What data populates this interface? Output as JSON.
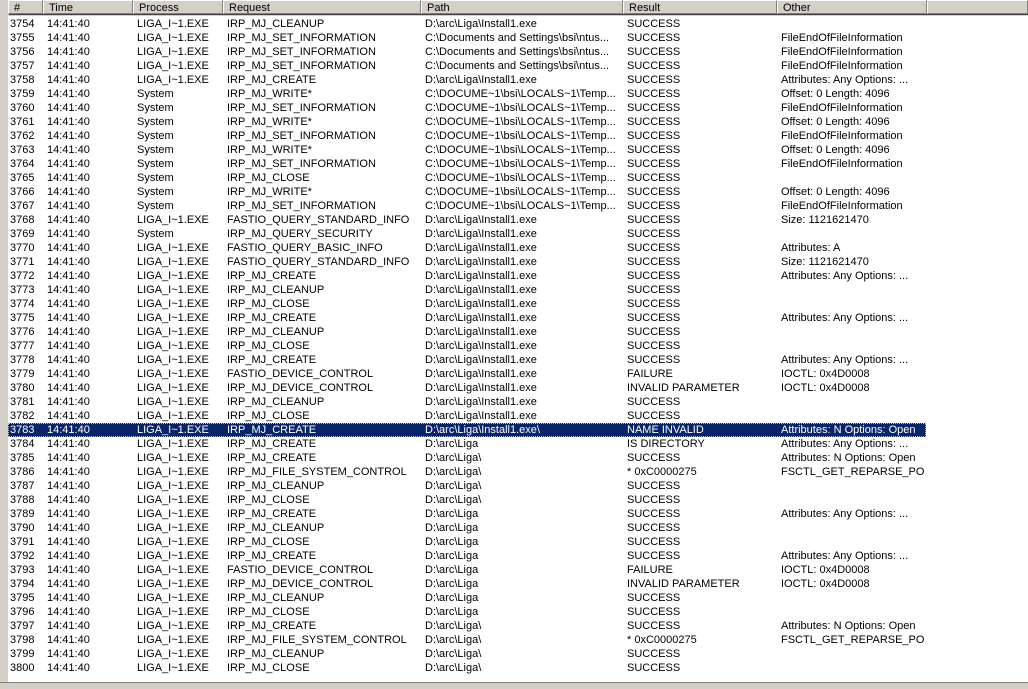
{
  "columns": [
    "#",
    "Time",
    "Process",
    "Request",
    "Path",
    "Result",
    "Other",
    ""
  ],
  "selected_index": 29,
  "selection_color": "#0a246a",
  "rows": [
    [
      "3754",
      "14:41:40",
      "LIGA_I~1.EXE",
      "IRP_MJ_CLEANUP",
      "D:\\arc\\Liga\\Install1.exe",
      "SUCCESS",
      ""
    ],
    [
      "3755",
      "14:41:40",
      "LIGA_I~1.EXE",
      "IRP_MJ_SET_INFORMATION",
      "C:\\Documents and Settings\\bsi\\ntus...",
      "SUCCESS",
      "FileEndOfFileInformation"
    ],
    [
      "3756",
      "14:41:40",
      "LIGA_I~1.EXE",
      "IRP_MJ_SET_INFORMATION",
      "C:\\Documents and Settings\\bsi\\ntus...",
      "SUCCESS",
      "FileEndOfFileInformation"
    ],
    [
      "3757",
      "14:41:40",
      "LIGA_I~1.EXE",
      "IRP_MJ_SET_INFORMATION",
      "C:\\Documents and Settings\\bsi\\ntus...",
      "SUCCESS",
      "FileEndOfFileInformation"
    ],
    [
      "3758",
      "14:41:40",
      "LIGA_I~1.EXE",
      "IRP_MJ_CREATE",
      "D:\\arc\\Liga\\Install1.exe",
      "SUCCESS",
      "Attributes: Any Options: ..."
    ],
    [
      "3759",
      "14:41:40",
      "System",
      "IRP_MJ_WRITE*",
      "C:\\DOCUME~1\\bsi\\LOCALS~1\\Temp...",
      "SUCCESS",
      "Offset: 0 Length: 4096"
    ],
    [
      "3760",
      "14:41:40",
      "System",
      "IRP_MJ_SET_INFORMATION",
      "C:\\DOCUME~1\\bsi\\LOCALS~1\\Temp...",
      "SUCCESS",
      "FileEndOfFileInformation"
    ],
    [
      "3761",
      "14:41:40",
      "System",
      "IRP_MJ_WRITE*",
      "C:\\DOCUME~1\\bsi\\LOCALS~1\\Temp...",
      "SUCCESS",
      "Offset: 0 Length: 4096"
    ],
    [
      "3762",
      "14:41:40",
      "System",
      "IRP_MJ_SET_INFORMATION",
      "C:\\DOCUME~1\\bsi\\LOCALS~1\\Temp...",
      "SUCCESS",
      "FileEndOfFileInformation"
    ],
    [
      "3763",
      "14:41:40",
      "System",
      "IRP_MJ_WRITE*",
      "C:\\DOCUME~1\\bsi\\LOCALS~1\\Temp...",
      "SUCCESS",
      "Offset: 0 Length: 4096"
    ],
    [
      "3764",
      "14:41:40",
      "System",
      "IRP_MJ_SET_INFORMATION",
      "C:\\DOCUME~1\\bsi\\LOCALS~1\\Temp...",
      "SUCCESS",
      "FileEndOfFileInformation"
    ],
    [
      "3765",
      "14:41:40",
      "System",
      "IRP_MJ_CLOSE",
      "C:\\DOCUME~1\\bsi\\LOCALS~1\\Temp...",
      "SUCCESS",
      ""
    ],
    [
      "3766",
      "14:41:40",
      "System",
      "IRP_MJ_WRITE*",
      "C:\\DOCUME~1\\bsi\\LOCALS~1\\Temp...",
      "SUCCESS",
      "Offset: 0 Length: 4096"
    ],
    [
      "3767",
      "14:41:40",
      "System",
      "IRP_MJ_SET_INFORMATION",
      "C:\\DOCUME~1\\bsi\\LOCALS~1\\Temp...",
      "SUCCESS",
      "FileEndOfFileInformation"
    ],
    [
      "3768",
      "14:41:40",
      "LIGA_I~1.EXE",
      "FASTIO_QUERY_STANDARD_INFO",
      "D:\\arc\\Liga\\Install1.exe",
      "SUCCESS",
      "Size: 1121621470"
    ],
    [
      "3769",
      "14:41:40",
      "System",
      "IRP_MJ_QUERY_SECURITY",
      "D:\\arc\\Liga\\Install1.exe",
      "SUCCESS",
      ""
    ],
    [
      "3770",
      "14:41:40",
      "LIGA_I~1.EXE",
      "FASTIO_QUERY_BASIC_INFO",
      "D:\\arc\\Liga\\Install1.exe",
      "SUCCESS",
      "Attributes: A"
    ],
    [
      "3771",
      "14:41:40",
      "LIGA_I~1.EXE",
      "FASTIO_QUERY_STANDARD_INFO",
      "D:\\arc\\Liga\\Install1.exe",
      "SUCCESS",
      "Size: 1121621470"
    ],
    [
      "3772",
      "14:41:40",
      "LIGA_I~1.EXE",
      "IRP_MJ_CREATE",
      "D:\\arc\\Liga\\Install1.exe",
      "SUCCESS",
      "Attributes: Any Options: ..."
    ],
    [
      "3773",
      "14:41:40",
      "LIGA_I~1.EXE",
      "IRP_MJ_CLEANUP",
      "D:\\arc\\Liga\\Install1.exe",
      "SUCCESS",
      ""
    ],
    [
      "3774",
      "14:41:40",
      "LIGA_I~1.EXE",
      "IRP_MJ_CLOSE",
      "D:\\arc\\Liga\\Install1.exe",
      "SUCCESS",
      ""
    ],
    [
      "3775",
      "14:41:40",
      "LIGA_I~1.EXE",
      "IRP_MJ_CREATE",
      "D:\\arc\\Liga\\Install1.exe",
      "SUCCESS",
      "Attributes: Any Options: ..."
    ],
    [
      "3776",
      "14:41:40",
      "LIGA_I~1.EXE",
      "IRP_MJ_CLEANUP",
      "D:\\arc\\Liga\\Install1.exe",
      "SUCCESS",
      ""
    ],
    [
      "3777",
      "14:41:40",
      "LIGA_I~1.EXE",
      "IRP_MJ_CLOSE",
      "D:\\arc\\Liga\\Install1.exe",
      "SUCCESS",
      ""
    ],
    [
      "3778",
      "14:41:40",
      "LIGA_I~1.EXE",
      "IRP_MJ_CREATE",
      "D:\\arc\\Liga\\Install1.exe",
      "SUCCESS",
      "Attributes: Any Options: ..."
    ],
    [
      "3779",
      "14:41:40",
      "LIGA_I~1.EXE",
      "FASTIO_DEVICE_CONTROL",
      "D:\\arc\\Liga\\Install1.exe",
      "FAILURE",
      "IOCTL: 0x4D0008"
    ],
    [
      "3780",
      "14:41:40",
      "LIGA_I~1.EXE",
      "IRP_MJ_DEVICE_CONTROL",
      "D:\\arc\\Liga\\Install1.exe",
      "INVALID PARAMETER",
      "IOCTL: 0x4D0008"
    ],
    [
      "3781",
      "14:41:40",
      "LIGA_I~1.EXE",
      "IRP_MJ_CLEANUP",
      "D:\\arc\\Liga\\Install1.exe",
      "SUCCESS",
      ""
    ],
    [
      "3782",
      "14:41:40",
      "LIGA_I~1.EXE",
      "IRP_MJ_CLOSE",
      "D:\\arc\\Liga\\Install1.exe",
      "SUCCESS",
      ""
    ],
    [
      "3783",
      "14:41:40",
      "LIGA_I~1.EXE",
      "IRP_MJ_CREATE",
      "D:\\arc\\Liga\\Install1.exe\\",
      "NAME INVALID",
      "Attributes: N Options: Open"
    ],
    [
      "3784",
      "14:41:40",
      "LIGA_I~1.EXE",
      "IRP_MJ_CREATE",
      "D:\\arc\\Liga",
      "IS DIRECTORY",
      "Attributes: Any Options: ..."
    ],
    [
      "3785",
      "14:41:40",
      "LIGA_I~1.EXE",
      "IRP_MJ_CREATE",
      "D:\\arc\\Liga\\",
      "SUCCESS",
      "Attributes: N Options: Open"
    ],
    [
      "3786",
      "14:41:40",
      "LIGA_I~1.EXE",
      "IRP_MJ_FILE_SYSTEM_CONTROL",
      "D:\\arc\\Liga\\",
      "* 0xC0000275",
      "FSCTL_GET_REPARSE_PO..."
    ],
    [
      "3787",
      "14:41:40",
      "LIGA_I~1.EXE",
      "IRP_MJ_CLEANUP",
      "D:\\arc\\Liga\\",
      "SUCCESS",
      ""
    ],
    [
      "3788",
      "14:41:40",
      "LIGA_I~1.EXE",
      "IRP_MJ_CLOSE",
      "D:\\arc\\Liga\\",
      "SUCCESS",
      ""
    ],
    [
      "3789",
      "14:41:40",
      "LIGA_I~1.EXE",
      "IRP_MJ_CREATE",
      "D:\\arc\\Liga",
      "SUCCESS",
      "Attributes: Any Options: ..."
    ],
    [
      "3790",
      "14:41:40",
      "LIGA_I~1.EXE",
      "IRP_MJ_CLEANUP",
      "D:\\arc\\Liga",
      "SUCCESS",
      ""
    ],
    [
      "3791",
      "14:41:40",
      "LIGA_I~1.EXE",
      "IRP_MJ_CLOSE",
      "D:\\arc\\Liga",
      "SUCCESS",
      ""
    ],
    [
      "3792",
      "14:41:40",
      "LIGA_I~1.EXE",
      "IRP_MJ_CREATE",
      "D:\\arc\\Liga",
      "SUCCESS",
      "Attributes: Any Options: ..."
    ],
    [
      "3793",
      "14:41:40",
      "LIGA_I~1.EXE",
      "FASTIO_DEVICE_CONTROL",
      "D:\\arc\\Liga",
      "FAILURE",
      "IOCTL: 0x4D0008"
    ],
    [
      "3794",
      "14:41:40",
      "LIGA_I~1.EXE",
      "IRP_MJ_DEVICE_CONTROL",
      "D:\\arc\\Liga",
      "INVALID PARAMETER",
      "IOCTL: 0x4D0008"
    ],
    [
      "3795",
      "14:41:40",
      "LIGA_I~1.EXE",
      "IRP_MJ_CLEANUP",
      "D:\\arc\\Liga",
      "SUCCESS",
      ""
    ],
    [
      "3796",
      "14:41:40",
      "LIGA_I~1.EXE",
      "IRP_MJ_CLOSE",
      "D:\\arc\\Liga",
      "SUCCESS",
      ""
    ],
    [
      "3797",
      "14:41:40",
      "LIGA_I~1.EXE",
      "IRP_MJ_CREATE",
      "D:\\arc\\Liga\\",
      "SUCCESS",
      "Attributes: N Options: Open"
    ],
    [
      "3798",
      "14:41:40",
      "LIGA_I~1.EXE",
      "IRP_MJ_FILE_SYSTEM_CONTROL",
      "D:\\arc\\Liga\\",
      "* 0xC0000275",
      "FSCTL_GET_REPARSE_PO..."
    ],
    [
      "3799",
      "14:41:40",
      "LIGA_I~1.EXE",
      "IRP_MJ_CLEANUP",
      "D:\\arc\\Liga\\",
      "SUCCESS",
      ""
    ],
    [
      "3800",
      "14:41:40",
      "LIGA_I~1.EXE",
      "IRP_MJ_CLOSE",
      "D:\\arc\\Liga\\",
      "SUCCESS",
      ""
    ]
  ]
}
